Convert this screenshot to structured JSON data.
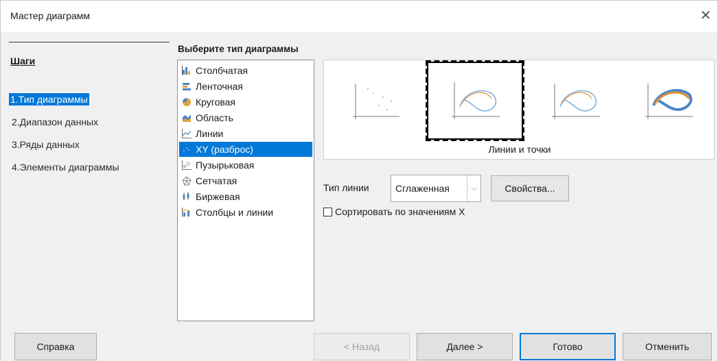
{
  "window": {
    "title": "Мастер диаграмм"
  },
  "steps": {
    "heading": "Шаги",
    "items": [
      {
        "label": "1.Тип диаграммы",
        "active": true
      },
      {
        "label": "2.Диапазон данных",
        "active": false
      },
      {
        "label": "3.Ряды данных",
        "active": false
      },
      {
        "label": "4.Элементы диаграммы",
        "active": false
      }
    ]
  },
  "chart_type": {
    "heading": "Выберите тип диаграммы",
    "items": [
      {
        "label": "Столбчатая",
        "icon": "bar-chart-icon"
      },
      {
        "label": "Ленточная",
        "icon": "horizontal-bar-icon"
      },
      {
        "label": "Круговая",
        "icon": "pie-chart-icon"
      },
      {
        "label": "Область",
        "icon": "area-chart-icon"
      },
      {
        "label": "Линии",
        "icon": "line-chart-icon"
      },
      {
        "label": "XY (разброс)",
        "icon": "scatter-chart-icon",
        "selected": true
      },
      {
        "label": "Пузырьковая",
        "icon": "bubble-chart-icon"
      },
      {
        "label": "Сетчатая",
        "icon": "net-chart-icon"
      },
      {
        "label": "Биржевая",
        "icon": "stock-chart-icon"
      },
      {
        "label": "Столбцы и линии",
        "icon": "column-line-icon"
      }
    ]
  },
  "variants": {
    "caption": "Линии и точки",
    "items": [
      {
        "name": "points-only",
        "selected": false
      },
      {
        "name": "points-and-lines",
        "selected": true
      },
      {
        "name": "lines-only",
        "selected": false
      },
      {
        "name": "3d-lines",
        "selected": false
      }
    ]
  },
  "line_type": {
    "label": "Тип линии",
    "value": "Сглаженная",
    "properties_label": "Свойства..."
  },
  "sort": {
    "label": "Сортировать по значениям X",
    "checked": false
  },
  "buttons": {
    "help": "Справка",
    "back": "< Назад",
    "next": "Далее >",
    "finish": "Готово",
    "cancel": "Отменить"
  },
  "colors": {
    "accent": "#0078d7",
    "curve": "#6fa8dc",
    "curve_orange": "#e69138"
  }
}
